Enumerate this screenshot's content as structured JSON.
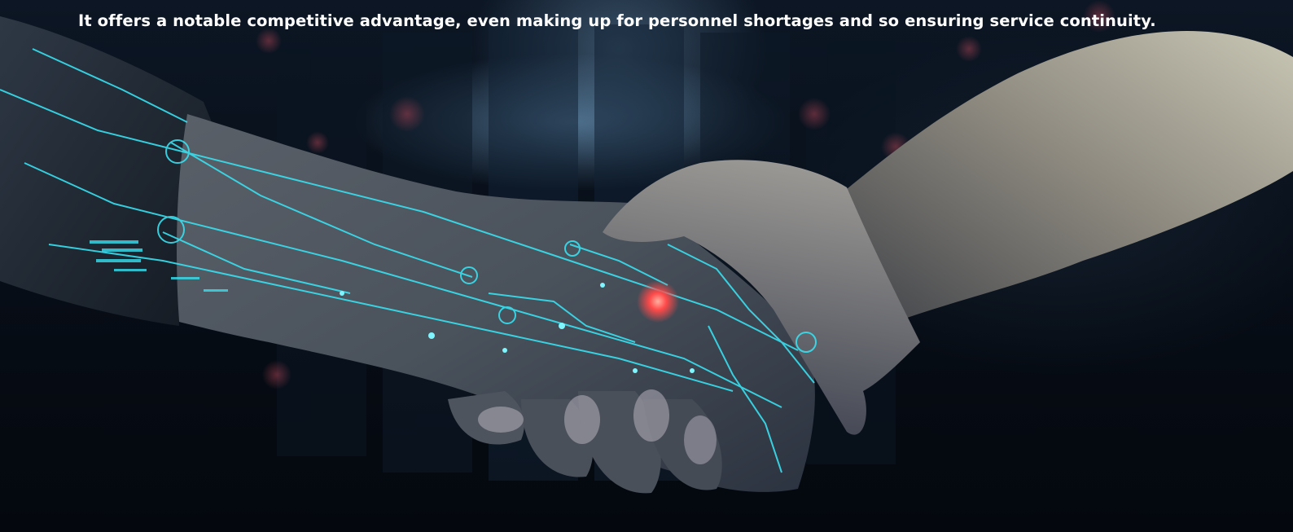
{
  "caption": {
    "text": "It offers a notable competitive advantage, even making up for personnel shortages and so ensuring service continuity."
  },
  "colors": {
    "background_dark": "#050a12",
    "circuit_glow": "#38e0f0",
    "accent_red": "#ff4a4a",
    "caption_text": "#ffffff"
  }
}
